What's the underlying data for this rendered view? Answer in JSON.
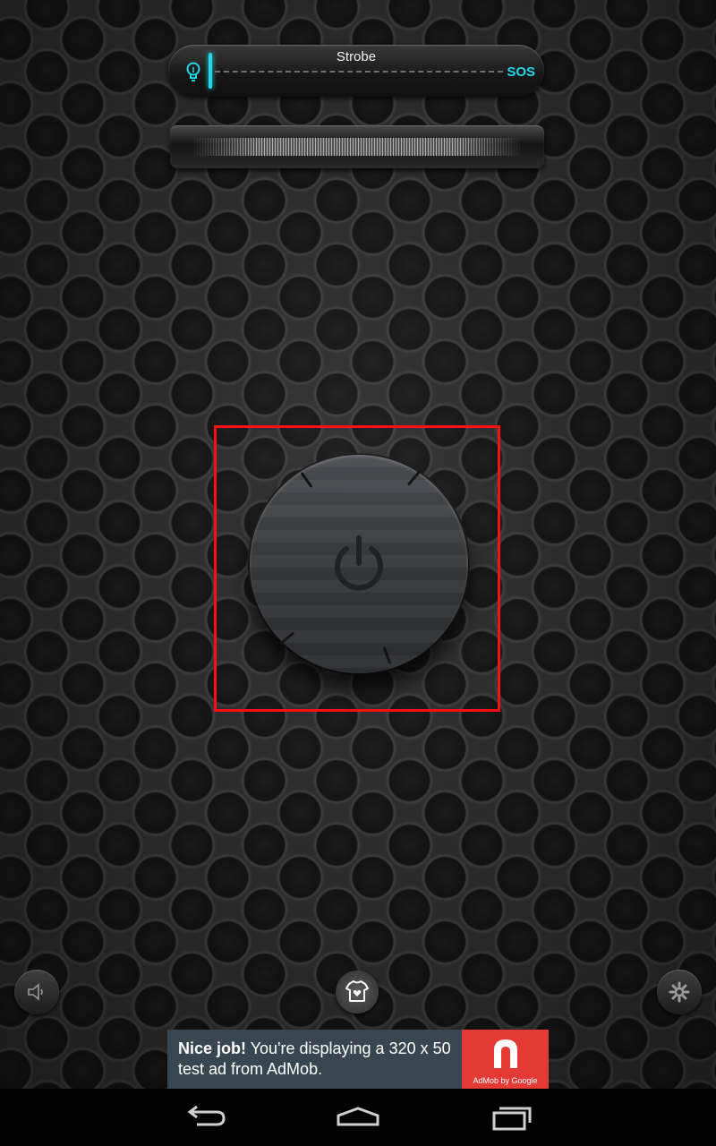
{
  "mode_selector": {
    "label": "Strobe",
    "sos_label": "SOS",
    "level": 0,
    "accent_color": "#22d8e6"
  },
  "icons": {
    "bulb": "bulb-icon",
    "power": "power-icon",
    "sound": "speaker-icon",
    "skin": "shirt-heart-icon",
    "settings": "gear-icon",
    "back": "back-icon",
    "home": "home-icon",
    "recents": "recents-icon"
  },
  "ad": {
    "headline": "Nice job!",
    "body": " You're displaying a 320 x 50 test ad from AdMob.",
    "logo_caption": "AdMob by Google",
    "logo_color": "#e53935"
  },
  "highlight_color": "#ff1010"
}
